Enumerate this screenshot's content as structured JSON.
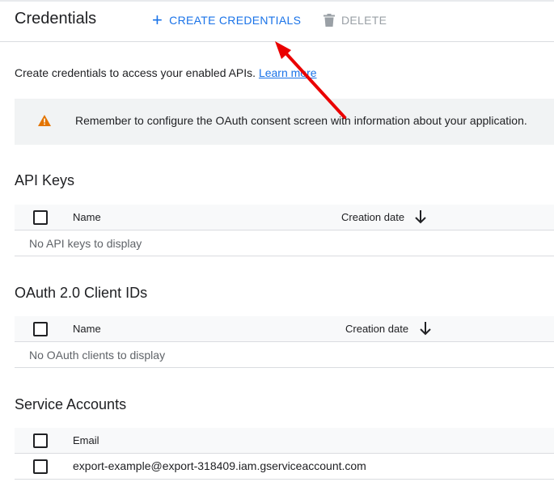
{
  "header": {
    "title": "Credentials",
    "create_label": "CREATE CREDENTIALS",
    "delete_label": "DELETE"
  },
  "intro": {
    "text": "Create credentials to access your enabled APIs.",
    "link": "Learn more"
  },
  "banner": {
    "message": "Remember to configure the OAuth consent screen with information about your application."
  },
  "api_keys": {
    "title": "API Keys",
    "columns": {
      "name": "Name",
      "creation_date": "Creation date"
    },
    "empty": "No API keys to display"
  },
  "oauth": {
    "title": "OAuth 2.0 Client IDs",
    "columns": {
      "name": "Name",
      "creation_date": "Creation date"
    },
    "empty": "No OAuth clients to display"
  },
  "service_accounts": {
    "title": "Service Accounts",
    "columns": {
      "email": "Email"
    },
    "rows": [
      {
        "email": "export-example@export-318409.iam.gserviceaccount.com"
      }
    ]
  },
  "colors": {
    "accent": "#1a73e8",
    "warning": "#e37400",
    "annotation_arrow": "#ea0000"
  },
  "icons": [
    "plus-icon",
    "trash-icon",
    "warning-icon",
    "arrow-down-icon"
  ]
}
